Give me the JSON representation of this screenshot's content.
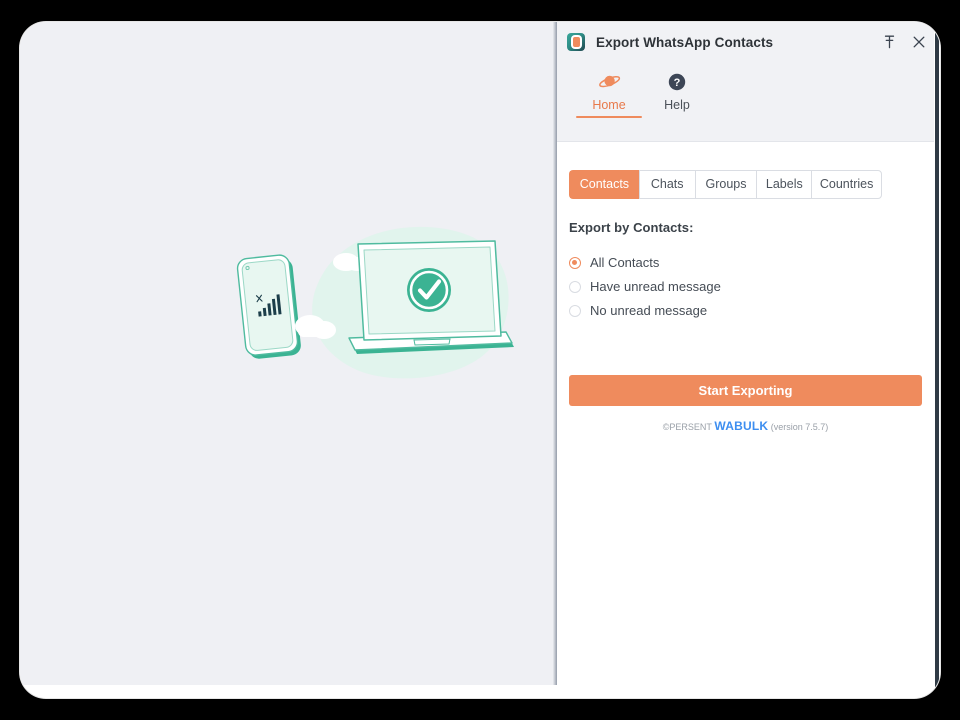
{
  "window": {
    "title": "Export WhatsApp Contacts",
    "app_icon": "app-logo-icon",
    "pin_icon": "pin-icon",
    "close_icon": "close-icon"
  },
  "nav": {
    "items": [
      {
        "label": "Home",
        "icon": "planet-icon",
        "active": true
      },
      {
        "label": "Help",
        "icon": "question-circle-icon",
        "active": false
      }
    ]
  },
  "tabs": {
    "items": [
      {
        "label": "Contacts",
        "active": true
      },
      {
        "label": "Chats",
        "active": false
      },
      {
        "label": "Groups",
        "active": false
      },
      {
        "label": "Labels",
        "active": false
      },
      {
        "label": "Countries",
        "active": false
      }
    ]
  },
  "export_section": {
    "title": "Export by Contacts:",
    "options": [
      {
        "label": "All Contacts",
        "checked": true
      },
      {
        "label": "Have unread message",
        "checked": false
      },
      {
        "label": "No unread message",
        "checked": false
      }
    ]
  },
  "actions": {
    "start_exporting": "Start Exporting"
  },
  "footer": {
    "copyright": "©PERSENT",
    "brand": "WABULK",
    "version": "(version 7.5.7)"
  },
  "illustration": {
    "name": "devices-sync-illustration",
    "phone_icon": "phone-signal-bars-icon",
    "laptop_icon": "laptop-check-icon",
    "cloud_icon": "cloud-icon",
    "check_icon": "check-circle-icon"
  },
  "colors": {
    "accent_orange": "#ef8b5d",
    "brand_blue": "#3d8ef0",
    "panel_gray": "#eff0f4",
    "header_gray": "#f1f2f5",
    "illustration_green": "#3bb393",
    "illustration_mint": "#dff3ec"
  }
}
